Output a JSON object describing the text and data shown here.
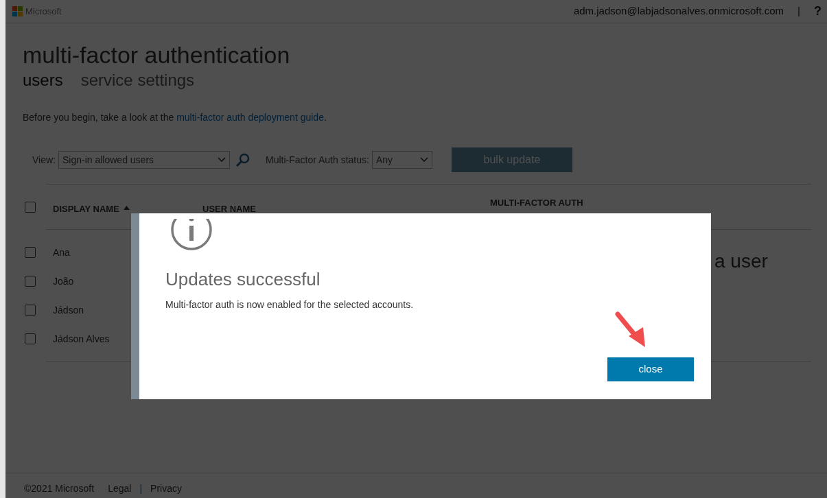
{
  "header": {
    "brand": "Microsoft",
    "account": "adm.jadson@labjadsonalves.onmicrosoft.com",
    "separator": "|",
    "help": "?"
  },
  "title": "multi-factor authentication",
  "tabs": [
    {
      "label": "users",
      "selected": true
    },
    {
      "label": "service settings",
      "selected": false
    }
  ],
  "intro": {
    "before": "Before you begin, take a look at the ",
    "link": "multi-factor auth deployment guide",
    "after": "."
  },
  "toolbar": {
    "view_label": "View:",
    "view_value": "Sign-in allowed users",
    "status_label": "Multi-Factor Auth status:",
    "status_value": "Any",
    "bulk_button": "bulk update"
  },
  "table": {
    "select_all_checked": false,
    "columns": [
      {
        "label": "DISPLAY NAME",
        "sorted": true
      },
      {
        "label": "USER NAME"
      },
      {
        "label": "MULTI-FACTOR AUTH"
      }
    ],
    "rows": [
      {
        "name": "Ana",
        "checked": false
      },
      {
        "name": "João",
        "checked": false
      },
      {
        "name": "Jádson",
        "checked": false
      },
      {
        "name": "Jádson Alves",
        "checked": false
      }
    ]
  },
  "side_text": "a user",
  "dialog": {
    "title": "Updates successful",
    "message": "Multi-factor auth is now enabled for the selected accounts.",
    "button": "close"
  },
  "footer": {
    "copyright": "©2021 Microsoft",
    "links": [
      "Legal",
      "Privacy"
    ],
    "separator": "|"
  }
}
